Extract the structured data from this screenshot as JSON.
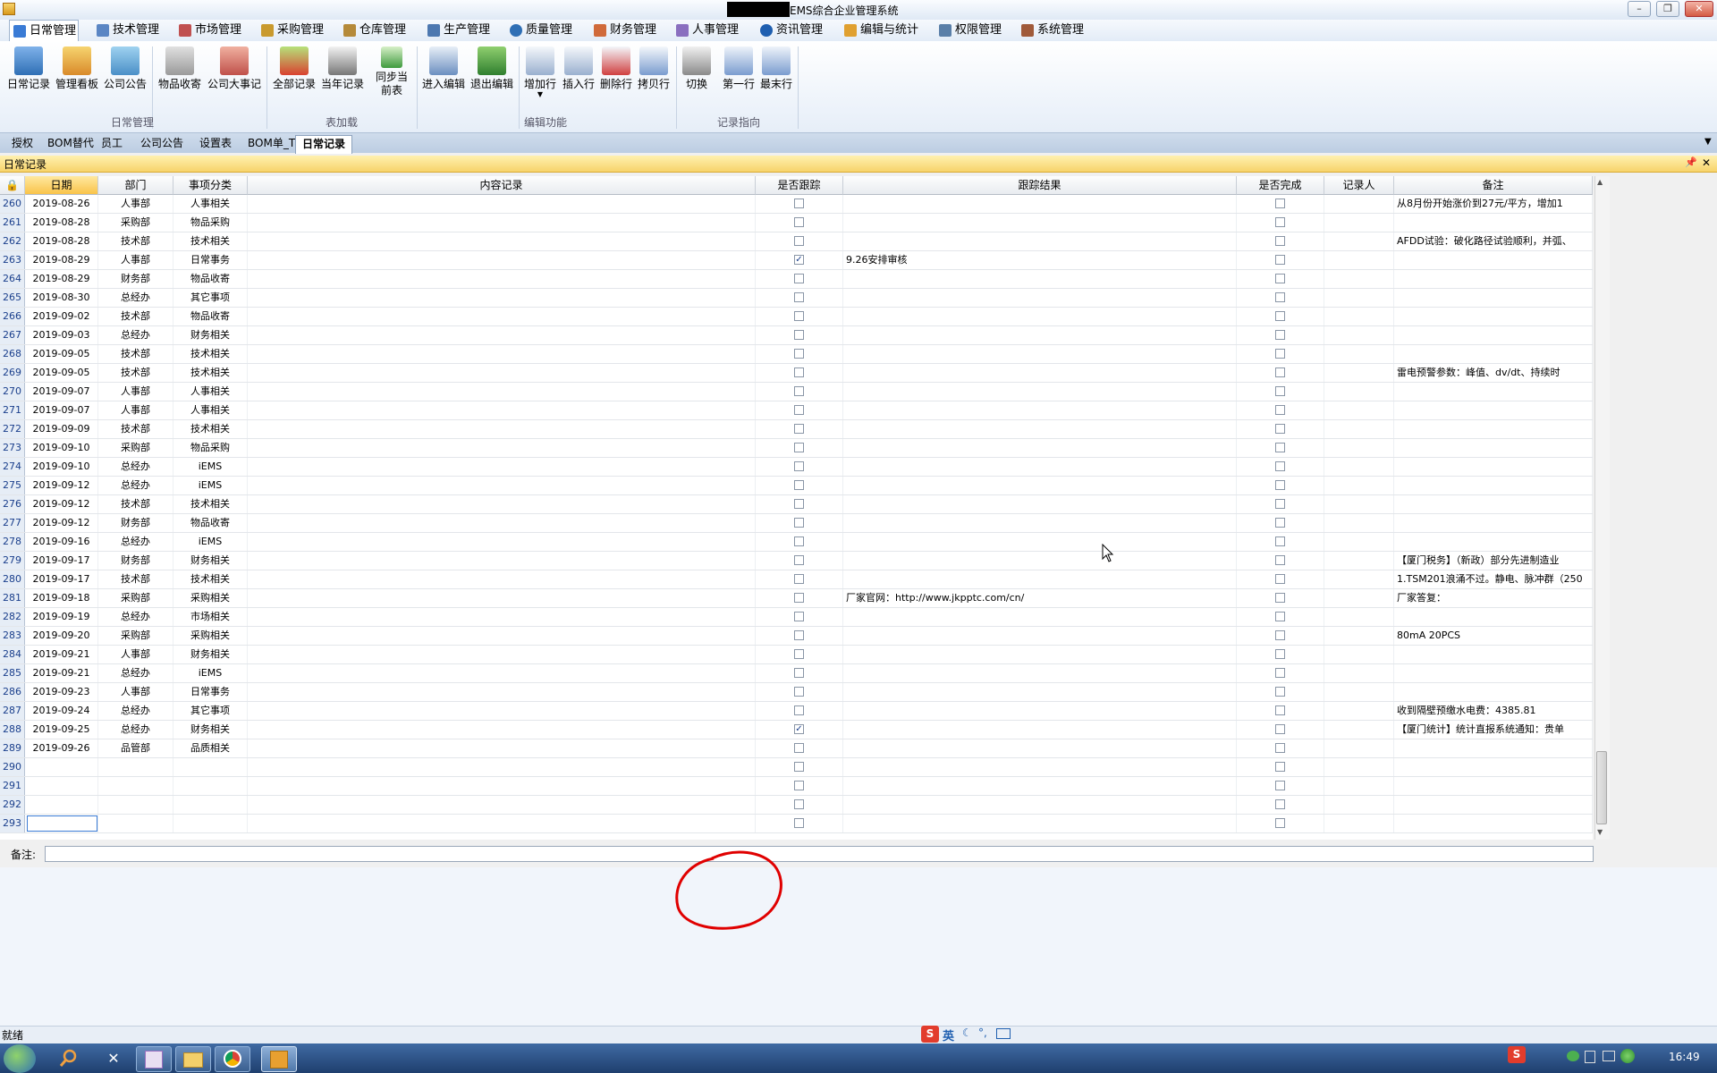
{
  "window": {
    "title": "EMS综合企业管理系统"
  },
  "menu": [
    "日常管理",
    "技术管理",
    "市场管理",
    "采购管理",
    "仓库管理",
    "生产管理",
    "质量管理",
    "财务管理",
    "人事管理",
    "资讯管理",
    "编辑与统计",
    "权限管理",
    "系统管理"
  ],
  "ribbon": {
    "buttons": [
      "日常记录",
      "管理看板",
      "公司公告",
      "物品收寄",
      "公司大事记",
      "全部记录",
      "当年记录",
      "同步当前表",
      "进入编辑",
      "退出编辑",
      "增加行",
      "插入行",
      "删除行",
      "拷贝行",
      "切换",
      "第一行",
      "最末行"
    ],
    "groups": [
      "日常管理",
      "表加载",
      "编辑功能",
      "记录指向"
    ]
  },
  "tabs": [
    "授权",
    "BOM替代",
    "员工",
    "公司公告",
    "设置表",
    "BOM单_T",
    "日常记录"
  ],
  "panel": {
    "title": "日常记录"
  },
  "grid": {
    "columns": [
      "日期",
      "部门",
      "事项分类",
      "内容记录",
      "是否跟踪",
      "跟踪结果",
      "是否完成",
      "记录人",
      "备注"
    ],
    "rows": [
      {
        "n": "260",
        "date": "2019-08-26",
        "dept": "人事部",
        "cat": "人事相关",
        "track": false,
        "result": "",
        "done": false,
        "note": "从8月份开始涨价到27元/平方，增加1"
      },
      {
        "n": "261",
        "date": "2019-08-28",
        "dept": "采购部",
        "cat": "物品采购",
        "track": false,
        "result": "",
        "done": false,
        "note": ""
      },
      {
        "n": "262",
        "date": "2019-08-28",
        "dept": "技术部",
        "cat": "技术相关",
        "track": false,
        "result": "",
        "done": false,
        "note": "AFDD试验：破化路径试验顺利，并弧、"
      },
      {
        "n": "263",
        "date": "2019-08-29",
        "dept": "人事部",
        "cat": "日常事务",
        "track": true,
        "result": "9.26安排审核",
        "done": false,
        "note": ""
      },
      {
        "n": "264",
        "date": "2019-08-29",
        "dept": "财务部",
        "cat": "物品收寄",
        "track": false,
        "result": "",
        "done": false,
        "note": ""
      },
      {
        "n": "265",
        "date": "2019-08-30",
        "dept": "总经办",
        "cat": "其它事项",
        "track": false,
        "result": "",
        "done": false,
        "note": ""
      },
      {
        "n": "266",
        "date": "2019-09-02",
        "dept": "技术部",
        "cat": "物品收寄",
        "track": false,
        "result": "",
        "done": false,
        "note": ""
      },
      {
        "n": "267",
        "date": "2019-09-03",
        "dept": "总经办",
        "cat": "财务相关",
        "track": false,
        "result": "",
        "done": false,
        "note": ""
      },
      {
        "n": "268",
        "date": "2019-09-05",
        "dept": "技术部",
        "cat": "技术相关",
        "track": false,
        "result": "",
        "done": false,
        "note": ""
      },
      {
        "n": "269",
        "date": "2019-09-05",
        "dept": "技术部",
        "cat": "技术相关",
        "track": false,
        "result": "",
        "done": false,
        "note": "雷电预警参数：峰值、dv/dt、持续时"
      },
      {
        "n": "270",
        "date": "2019-09-07",
        "dept": "人事部",
        "cat": "人事相关",
        "track": false,
        "result": "",
        "done": false,
        "note": ""
      },
      {
        "n": "271",
        "date": "2019-09-07",
        "dept": "人事部",
        "cat": "人事相关",
        "track": false,
        "result": "",
        "done": false,
        "note": ""
      },
      {
        "n": "272",
        "date": "2019-09-09",
        "dept": "技术部",
        "cat": "技术相关",
        "track": false,
        "result": "",
        "done": false,
        "note": ""
      },
      {
        "n": "273",
        "date": "2019-09-10",
        "dept": "采购部",
        "cat": "物品采购",
        "track": false,
        "result": "",
        "done": false,
        "note": ""
      },
      {
        "n": "274",
        "date": "2019-09-10",
        "dept": "总经办",
        "cat": "iEMS",
        "track": false,
        "result": "",
        "done": false,
        "note": ""
      },
      {
        "n": "275",
        "date": "2019-09-12",
        "dept": "总经办",
        "cat": "iEMS",
        "track": false,
        "result": "",
        "done": false,
        "note": ""
      },
      {
        "n": "276",
        "date": "2019-09-12",
        "dept": "技术部",
        "cat": "技术相关",
        "track": false,
        "result": "",
        "done": false,
        "note": ""
      },
      {
        "n": "277",
        "date": "2019-09-12",
        "dept": "财务部",
        "cat": "物品收寄",
        "track": false,
        "result": "",
        "done": false,
        "note": ""
      },
      {
        "n": "278",
        "date": "2019-09-16",
        "dept": "总经办",
        "cat": "iEMS",
        "track": false,
        "result": "",
        "done": false,
        "note": ""
      },
      {
        "n": "279",
        "date": "2019-09-17",
        "dept": "财务部",
        "cat": "财务相关",
        "track": false,
        "result": "",
        "done": false,
        "note": "【厦门税务】（新政）部分先进制造业"
      },
      {
        "n": "280",
        "date": "2019-09-17",
        "dept": "技术部",
        "cat": "技术相关",
        "track": false,
        "result": "",
        "done": false,
        "note": "1.TSM201浪涌不过。静电、脉冲群（250"
      },
      {
        "n": "281",
        "date": "2019-09-18",
        "dept": "采购部",
        "cat": "采购相关",
        "track": false,
        "result": "厂家官网：http://www.jkpptc.com/cn/",
        "done": false,
        "note": "厂家答复："
      },
      {
        "n": "282",
        "date": "2019-09-19",
        "dept": "总经办",
        "cat": "市场相关",
        "track": false,
        "result": "",
        "done": false,
        "note": ""
      },
      {
        "n": "283",
        "date": "2019-09-20",
        "dept": "采购部",
        "cat": "采购相关",
        "track": false,
        "result": "",
        "done": false,
        "note": "80mA 20PCS"
      },
      {
        "n": "284",
        "date": "2019-09-21",
        "dept": "人事部",
        "cat": "财务相关",
        "track": false,
        "result": "",
        "done": false,
        "note": ""
      },
      {
        "n": "285",
        "date": "2019-09-21",
        "dept": "总经办",
        "cat": "iEMS",
        "track": false,
        "result": "",
        "done": false,
        "note": ""
      },
      {
        "n": "286",
        "date": "2019-09-23",
        "dept": "人事部",
        "cat": "日常事务",
        "track": false,
        "result": "",
        "done": false,
        "note": ""
      },
      {
        "n": "287",
        "date": "2019-09-24",
        "dept": "总经办",
        "cat": "其它事项",
        "track": false,
        "result": "",
        "done": false,
        "note": "收到隔壁预缴水电费：4385.81"
      },
      {
        "n": "288",
        "date": "2019-09-25",
        "dept": "总经办",
        "cat": "财务相关",
        "track": true,
        "result": "",
        "done": false,
        "note": "【厦门统计】统计直报系统通知：贵单"
      },
      {
        "n": "289",
        "date": "2019-09-26",
        "dept": "品管部",
        "cat": "品质相关",
        "track": false,
        "result": "",
        "done": false,
        "note": ""
      },
      {
        "n": "290",
        "date": "",
        "dept": "",
        "cat": "",
        "track": false,
        "result": "",
        "done": false,
        "note": ""
      },
      {
        "n": "291",
        "date": "",
        "dept": "",
        "cat": "",
        "track": false,
        "result": "",
        "done": false,
        "note": ""
      },
      {
        "n": "292",
        "date": "",
        "dept": "",
        "cat": "",
        "track": false,
        "result": "",
        "done": false,
        "note": ""
      },
      {
        "n": "293",
        "date": "",
        "dept": "",
        "cat": "",
        "track": false,
        "result": "",
        "done": false,
        "note": ""
      }
    ]
  },
  "notes": {
    "label": "备注:"
  },
  "status": {
    "text": "就绪"
  },
  "ime": {
    "lang": "英"
  },
  "clock": "16:49",
  "colors": {
    "accent": "#3a7bd5",
    "panel": "#f7d36b",
    "annotation": "#e00000"
  }
}
